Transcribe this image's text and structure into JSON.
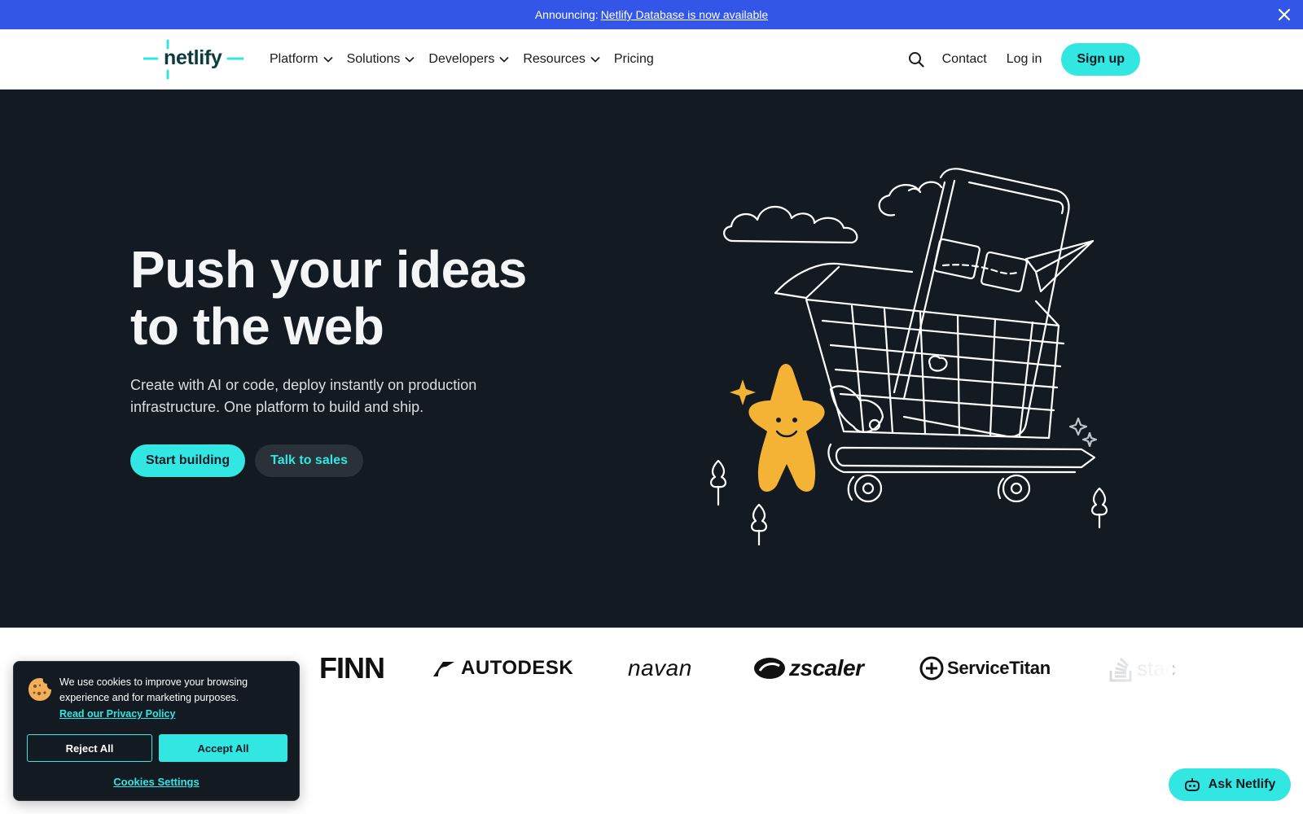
{
  "announcement": {
    "prefix": "Announcing:",
    "link": "Netlify Database is now available"
  },
  "header": {
    "logo_text": "netlify",
    "nav": [
      "Platform",
      "Solutions",
      "Developers",
      "Resources",
      "Pricing"
    ],
    "contact": "Contact",
    "login": "Log in",
    "signup": "Sign up"
  },
  "hero": {
    "title_line1": "Push your ideas",
    "title_line2": "to the web",
    "subtitle": "Create with AI or code, deploy instantly on production infrastructure. One platform to build and ship.",
    "primary_cta": "Start building",
    "secondary_cta": "Talk to sales"
  },
  "logos": [
    "FINN",
    "AUTODESK",
    "navan",
    "zscaler",
    "ServiceTitan",
    "stac"
  ],
  "cookie": {
    "text": "We use cookies to improve your browsing experience and for marketing purposes.",
    "privacy_link": "Read our Privacy Policy",
    "reject": "Reject All",
    "accept": "Accept All",
    "settings": "Cookies Settings"
  },
  "ask": {
    "label": "Ask Netlify"
  },
  "colors": {
    "announcement_bg": "#3356e8",
    "accent": "#32e6e2",
    "hero_bg": "#131a22",
    "mascot": "#f5b335"
  }
}
